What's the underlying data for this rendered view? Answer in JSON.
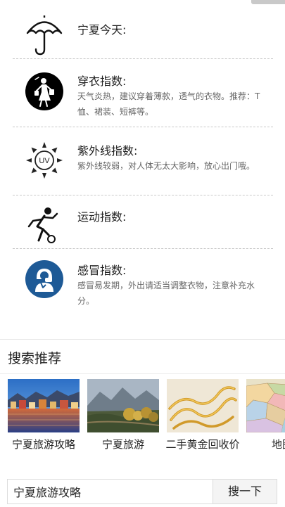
{
  "indices": {
    "today": {
      "title": "宁夏今天:"
    },
    "dress": {
      "title": "穿衣指数:",
      "desc": "天气炎热，建议穿着薄款，透气的衣物。推荐：T恤、裙装、短裤等。"
    },
    "uv": {
      "title": "紫外线指数:",
      "desc": "紫外线较弱，对人体无太大影响，放心出门哦。",
      "icon_text": "UV"
    },
    "sport": {
      "title": "运动指数:"
    },
    "cold": {
      "title": "感冒指数:",
      "desc": "感冒易发期，外出请适当调整衣物，注意补充水分。"
    }
  },
  "search_recommend": {
    "heading": "搜索推荐",
    "cards": [
      {
        "label": "宁夏旅游攻略"
      },
      {
        "label": "宁夏旅游"
      },
      {
        "label": "二手黄金回收价"
      },
      {
        "label": "地图"
      }
    ]
  },
  "query": {
    "value": "宁夏旅游攻略",
    "button_label": "搜一下"
  },
  "icons": [
    "umbrella-icon",
    "dress-icon",
    "uv-sun-icon",
    "sport-icon",
    "cold-icon"
  ],
  "colors": {
    "accent_blue": "#1e5a96",
    "text_muted": "#666666"
  }
}
